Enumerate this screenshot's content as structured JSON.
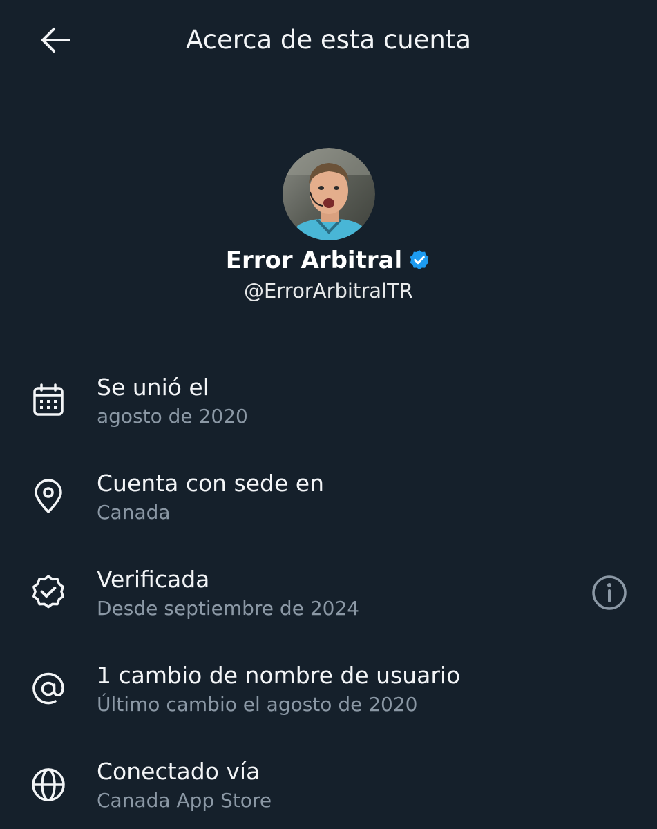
{
  "header": {
    "title": "Acerca de esta cuenta",
    "back_icon": "arrow-left-icon"
  },
  "profile": {
    "display_name": "Error Arbitral",
    "handle": "@ErrorArbitralTR",
    "verified": true,
    "verified_badge_color": "#1d9bf0",
    "avatar_icon": "avatar"
  },
  "info": [
    {
      "icon": "calendar-icon",
      "title": "Se unió el",
      "subtitle": "agosto de 2020"
    },
    {
      "icon": "location-pin-icon",
      "title": "Cuenta con sede en",
      "subtitle": "Canada"
    },
    {
      "icon": "verified-badge-icon",
      "title": "Verificada",
      "subtitle": "Desde septiembre de 2024",
      "action_icon": "info-icon"
    },
    {
      "icon": "at-sign-icon",
      "title": "1 cambio de nombre de usuario",
      "subtitle": "Último cambio el agosto de 2020"
    },
    {
      "icon": "globe-icon",
      "title": "Conectado vía",
      "subtitle": "Canada App Store"
    }
  ],
  "colors": {
    "background": "#15202b",
    "primary_text": "#f3f5f7",
    "secondary_text": "#8b98a5",
    "accent": "#1d9bf0"
  }
}
